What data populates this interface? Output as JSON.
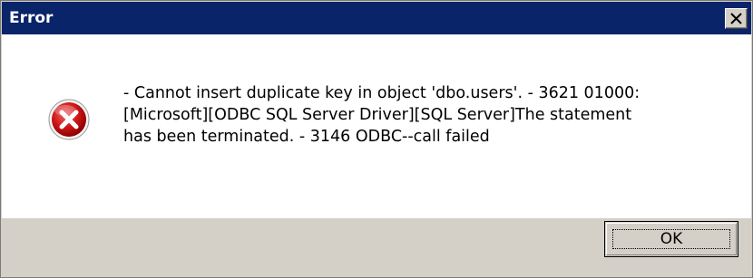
{
  "window": {
    "title": "Error"
  },
  "titlebar": {
    "close_icon": "close-icon"
  },
  "dialog": {
    "icon": "error-icon",
    "message": " - Cannot insert duplicate key in object 'dbo.users'. - 3621 01000:\n[Microsoft][ODBC SQL Server Driver][SQL Server]The statement\nhas been terminated. - 3146 ODBC--call failed"
  },
  "buttons": {
    "ok_label": "OK"
  },
  "colors": {
    "titlebar": "#0a246a",
    "content_bg": "#ffffff",
    "footer_bg": "#d4d0c8",
    "error_red": "#c8102e"
  }
}
